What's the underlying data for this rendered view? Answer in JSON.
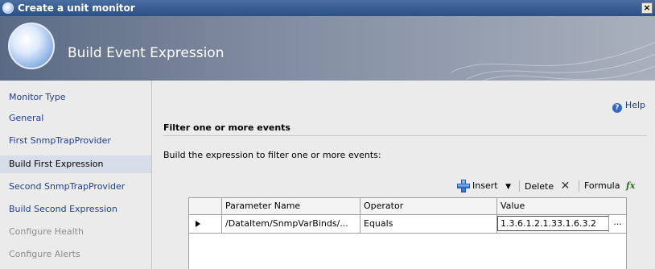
{
  "window": {
    "title": "Create a unit monitor",
    "close_label": "×"
  },
  "banner": {
    "title": "Build Event Expression"
  },
  "nav": {
    "items": [
      {
        "label": "Monitor Type",
        "state": "link"
      },
      {
        "label": "General",
        "state": "link"
      },
      {
        "label": "First SnmpTrapProvider",
        "state": "link"
      },
      {
        "label": "Build First Expression",
        "state": "active"
      },
      {
        "label": "Second SnmpTrapProvider",
        "state": "link"
      },
      {
        "label": "Build Second Expression",
        "state": "link"
      },
      {
        "label": "Configure Health",
        "state": "disabled"
      },
      {
        "label": "Configure Alerts",
        "state": "disabled"
      }
    ]
  },
  "main": {
    "help_label": "Help",
    "section_title": "Filter one or more events",
    "instructions": "Build the expression to filter one or more events:"
  },
  "toolbar": {
    "insert_label": "Insert",
    "delete_label": "Delete",
    "formula_label": "Formula"
  },
  "grid": {
    "columns": [
      "Parameter Name",
      "Operator",
      "Value"
    ],
    "rows": [
      {
        "parameter": "/DataItem/SnmpVarBinds/...",
        "operator": "Equals",
        "value": "1.3.6.1.2.1.33.1.6.3.2",
        "ellipsis": "..."
      }
    ]
  },
  "colors": {
    "link": "#1f3e8c",
    "active_nav": "#d7dde9",
    "title_bar": "#2c4f86"
  }
}
